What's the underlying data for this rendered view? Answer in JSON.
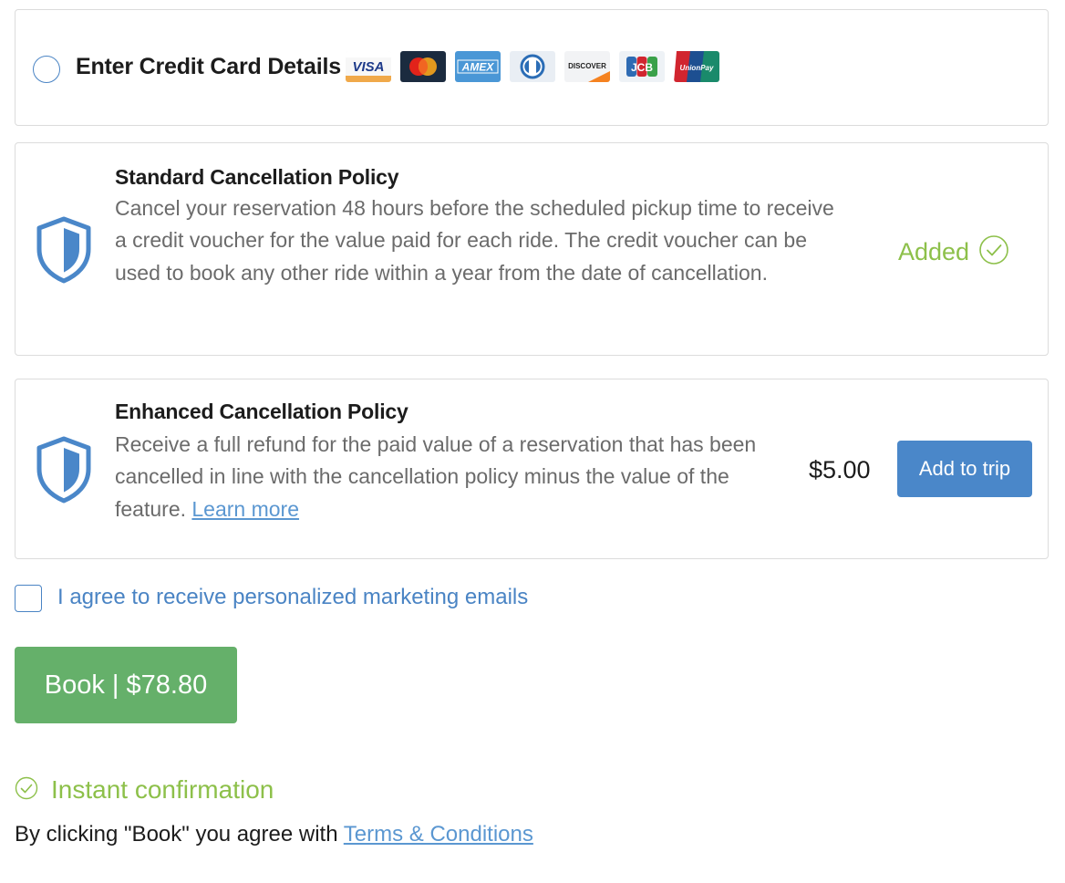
{
  "payment": {
    "credit_card_label": "Enter Credit Card Details",
    "brands": [
      "VISA",
      "mastercard",
      "AMEX",
      "diners",
      "DISCOVER",
      "JCB",
      "UnionPay"
    ]
  },
  "standard_policy": {
    "title": "Standard Cancellation Policy",
    "body": "Cancel your reservation 48 hours before the scheduled pickup time to receive a credit voucher for the value paid for each ride. The credit voucher can be used to book any other ride within a year from the date of cancellation.",
    "status": "Added"
  },
  "enhanced_policy": {
    "title": "Enhanced Cancellation Policy",
    "body": "Receive a full refund for the paid value of a reservation that has been cancelled in line with the cancellation policy minus the value of the feature.",
    "learn_more": "Learn more",
    "price": "$5.00",
    "add_button": "Add to trip"
  },
  "marketing": {
    "label": "I agree to receive personalized marketing emails"
  },
  "book": {
    "label": "Book | $78.80"
  },
  "confirmation": {
    "text": "Instant confirmation"
  },
  "terms": {
    "prefix": "By clicking \"Book\" you agree with ",
    "link": "Terms & Conditions"
  },
  "colors": {
    "accent_blue": "#4a87c9",
    "success_green": "#8dc04a",
    "book_green": "#65b06a",
    "link_blue": "#5b97d1"
  }
}
